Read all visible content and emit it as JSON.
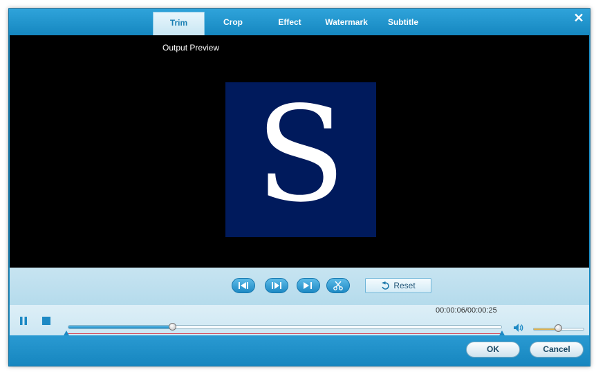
{
  "tabs": [
    {
      "label": "Trim",
      "active": true
    },
    {
      "label": "Crop",
      "active": false
    },
    {
      "label": "Effect",
      "active": false
    },
    {
      "label": "Watermark",
      "active": false
    },
    {
      "label": "Subtitle",
      "active": false
    }
  ],
  "close_label": "✕",
  "preview": {
    "label": "Output Preview",
    "logo_letter": "S"
  },
  "controls": {
    "reset_label": "Reset"
  },
  "timeline": {
    "time": "00:00:06/00:00:25",
    "progress_fraction": 0.24,
    "volume_fraction": 0.48
  },
  "footer": {
    "ok_label": "OK",
    "cancel_label": "Cancel"
  },
  "colors": {
    "accent": "#1a8cc4",
    "preview_bg": "#000000",
    "logo_bg": "#001a5c"
  }
}
